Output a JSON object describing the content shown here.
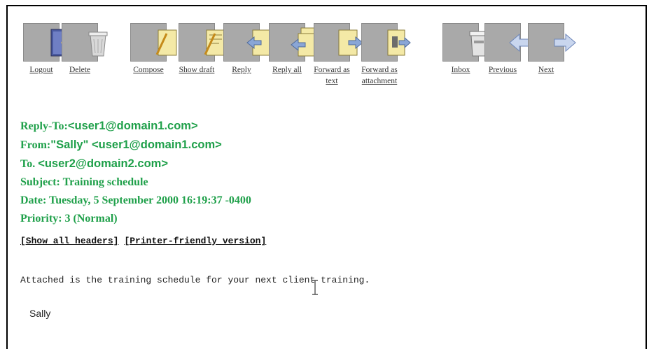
{
  "toolbar": {
    "logout": "Logout",
    "delete": "Delete",
    "compose": "Compose",
    "show_draft": "Show draft",
    "reply": "Reply",
    "reply_all": "Reply all",
    "forward_as_text": "Forward as text",
    "forward_as_attachment": "Forward as attachment",
    "inbox": "Inbox",
    "previous": "Previous",
    "next": "Next"
  },
  "headers": {
    "reply_to_label": "Reply-To:",
    "reply_to_value": "<user1@domain1.com>",
    "from_label": "From:",
    "from_value": "\"Sally\" <user1@domain1.com>",
    "to_label": "To.",
    "to_value": "<user2@domain2.com>",
    "subject": "Subject: Training schedule",
    "date": "Date: Tuesday, 5 September 2000 16:19:37 -0400",
    "priority": "Priority: 3 (Normal)"
  },
  "links": {
    "show_all_headers": "[Show all headers]",
    "printer_friendly": "[Printer-friendly version]"
  },
  "message": {
    "body": "Attached is the training schedule for your next client training.",
    "signature": "Sally"
  },
  "colors": {
    "header_green": "#1fa04a",
    "icon_gray": "#a9a9a9",
    "paper_yellow": "#f4e9a6"
  }
}
